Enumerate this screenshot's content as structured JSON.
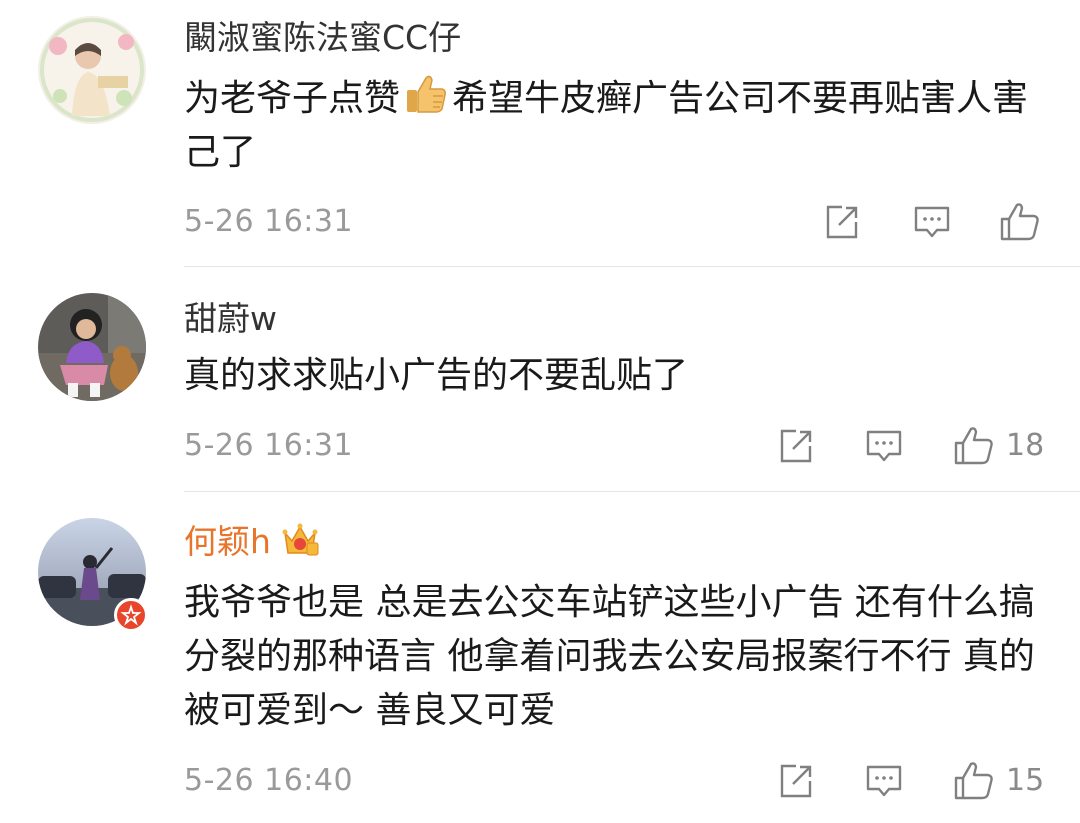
{
  "comments": [
    {
      "username": "闞淑蜜陈法蜜CC仔",
      "text_before": "为老爷子点赞",
      "text_after": "希望牛皮癣广告公司不要再贴害人害己了",
      "time": "5-26 16:31",
      "likes": ""
    },
    {
      "username": "甜蔚w",
      "text": "真的求求贴小广告的不要乱贴了",
      "time": "5-26 16:31",
      "likes": "18"
    },
    {
      "username": "何颖h",
      "text": "我爷爷也是 总是去公交车站铲这些小广告 还有什么搞分裂的那种语言 他拿着问我去公安局报案行不行 真的被可爱到～ 善良又可爱",
      "time": "5-26 16:40",
      "likes": "15"
    }
  ],
  "icons": {
    "share": "share-icon",
    "comment": "comment-icon",
    "like": "like-icon",
    "thumbs_up_emoji": "thumbs-up-emoji-icon",
    "crown": "vip-crown-icon",
    "verified": "verified-badge-icon"
  },
  "colors": {
    "username": "#333333",
    "vip_username": "#e8752b",
    "time": "#9a9a9a",
    "divider": "#e6e6e6",
    "text": "#1a1a1a"
  }
}
